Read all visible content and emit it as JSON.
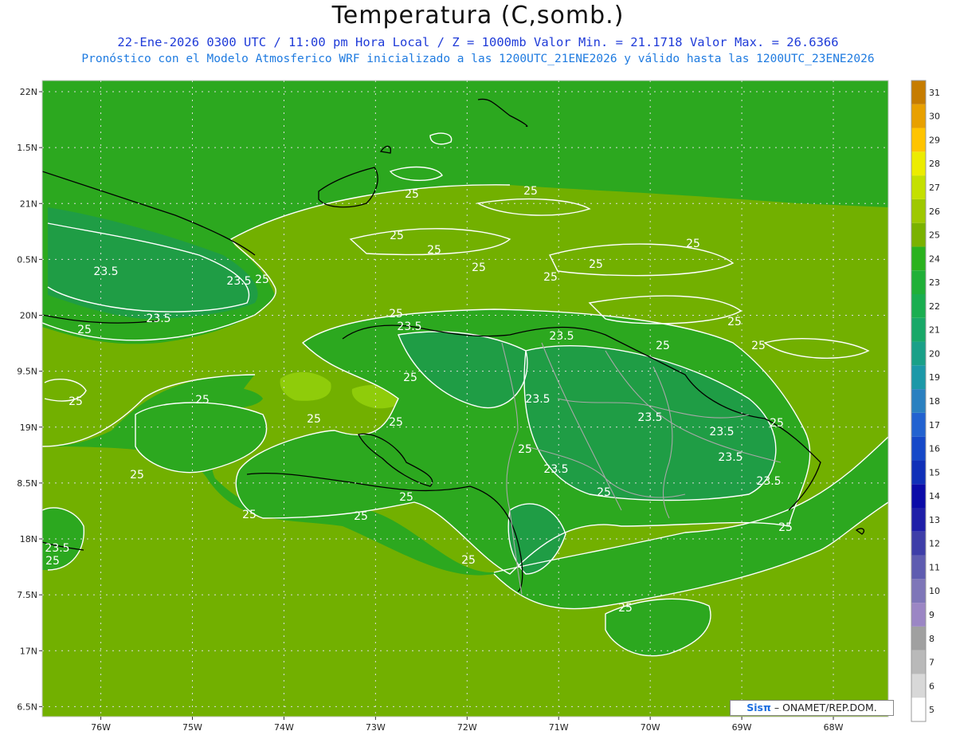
{
  "header": {
    "title": "Temperatura (C,somb.)",
    "line1": "22-Ene-2026 0300 UTC / 11:00 pm Hora Local / Z = 1000mb  Valor Min. = 21.1718  Valor Max. = 26.6366",
    "line2": "Pronóstico con el Modelo Atmosferico WRF inicializado a las 1200UTC_21ENE2026 y válido hasta las  1200UTC_23ENE2026"
  },
  "axes": {
    "lat_labels": [
      "22N",
      "1.5N",
      "21N",
      "0.5N",
      "20N",
      "9.5N",
      "19N",
      "8.5N",
      "18N",
      "7.5N",
      "17N",
      "6.5N"
    ],
    "lat_values": [
      22,
      21.5,
      21,
      20.5,
      20,
      19.5,
      19,
      18.5,
      18,
      17.5,
      17,
      16.5
    ],
    "lon_labels": [
      "76W",
      "75W",
      "74W",
      "73W",
      "72W",
      "71W",
      "70W",
      "69W",
      "68W"
    ],
    "lon_values": [
      -76,
      -75,
      -74,
      -73,
      -72,
      -71,
      -70,
      -69,
      -68
    ],
    "lat_range": [
      16.41,
      22.1
    ],
    "lon_range": [
      -76.64,
      -67.4
    ]
  },
  "colorbar": {
    "levels": [
      5,
      6,
      7,
      8,
      9,
      10,
      11,
      12,
      13,
      14,
      15,
      16,
      17,
      18,
      19,
      20,
      21,
      22,
      23,
      24,
      25,
      26,
      27,
      28,
      29,
      30,
      31
    ],
    "colors": [
      "#ffffff",
      "#d8d8d8",
      "#b9b9b9",
      "#a0a0a0",
      "#9b86c4",
      "#7e76b8",
      "#5e5cb0",
      "#3e3ea8",
      "#1f1fa8",
      "#0b0ba8",
      "#1030b8",
      "#1548c8",
      "#2262d0",
      "#2a80c0",
      "#1c98a8",
      "#1aa088",
      "#19a868",
      "#1aae50",
      "#20b038",
      "#2ab21e",
      "#7ab200",
      "#9ec800",
      "#c4e000",
      "#ecec00",
      "#ffc400",
      "#e8a000",
      "#c67c00"
    ]
  },
  "contour_labels": [
    "25",
    "23.5"
  ],
  "regions": {
    "warm_fill": "#72b000",
    "cool_fill": "#2ca81f",
    "coolest_fill": "#1f9d45",
    "warmest_fill": "#8fcc0a"
  },
  "credit": {
    "logo": "Sisπ",
    "text": "– ONAMET/REP.DOM."
  }
}
